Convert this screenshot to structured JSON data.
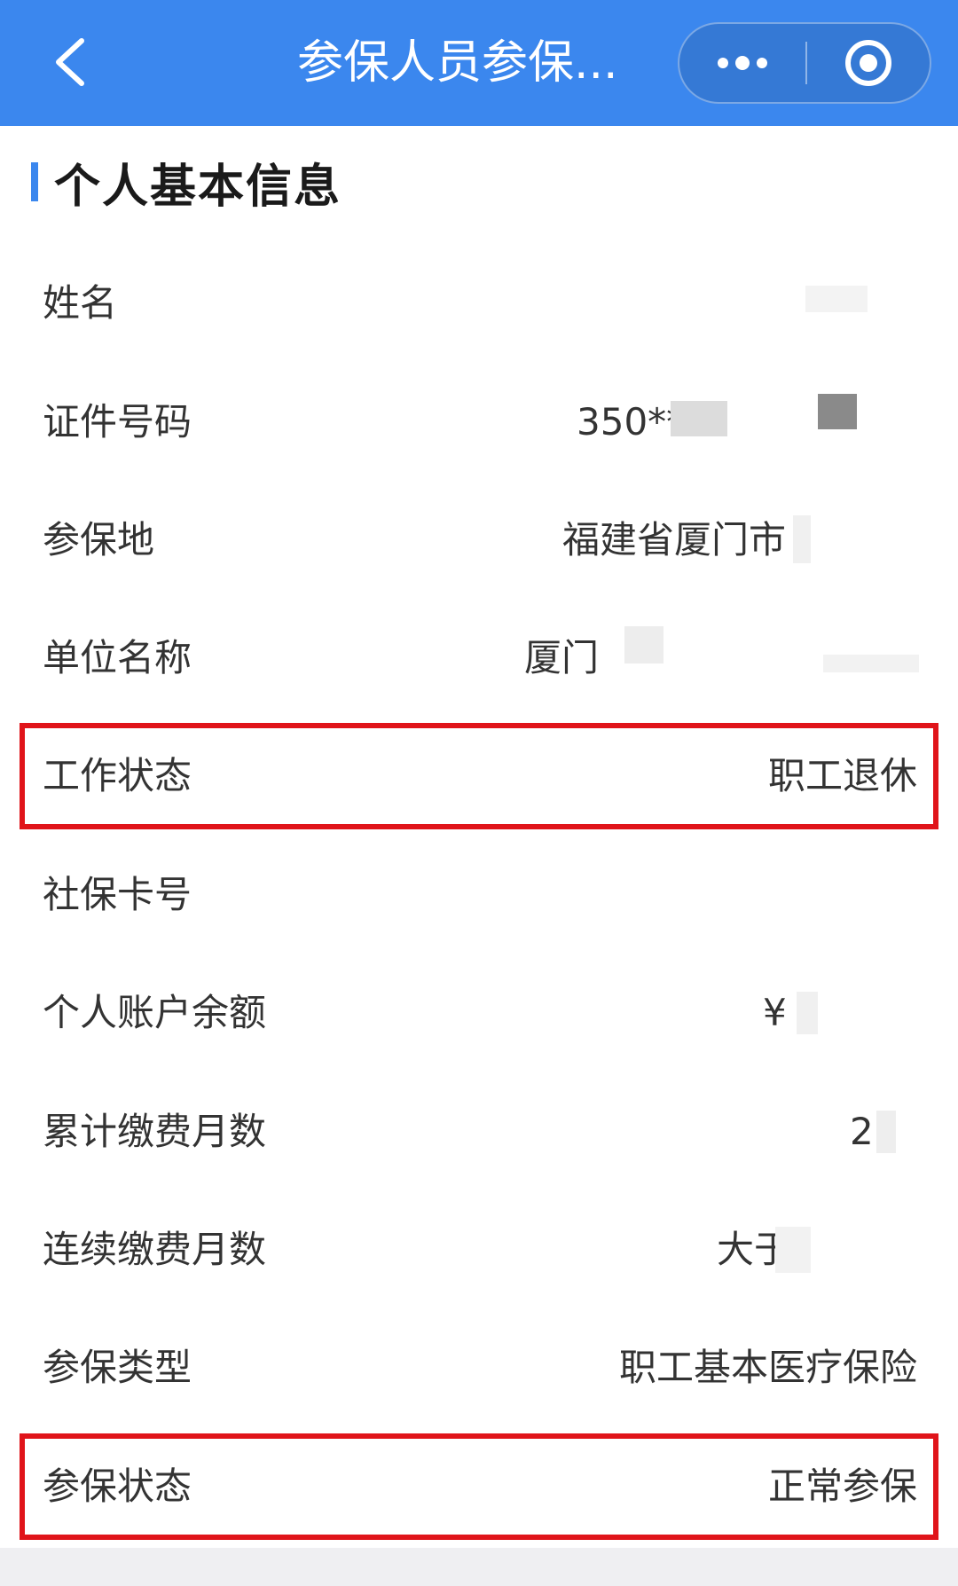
{
  "header": {
    "title": "参保人员参保...",
    "back_icon": "chevron-left-icon",
    "more_icon": "more-dots-icon",
    "close_icon": "target-circle-icon",
    "bg_color": "#3b87ee"
  },
  "section": {
    "title": "个人基本信息",
    "accent_color": "#3b87ee"
  },
  "rows": [
    {
      "label": "姓名",
      "value": ""
    },
    {
      "label": "证件号码",
      "value": "350**"
    },
    {
      "label": "参保地",
      "value": "福建省厦门市"
    },
    {
      "label": "单位名称",
      "value": "厦门"
    },
    {
      "label": "工作状态",
      "value": "职工退休",
      "highlighted": true
    },
    {
      "label": "社保卡号",
      "value": ""
    },
    {
      "label": "个人账户余额",
      "value": "¥"
    },
    {
      "label": "累计缴费月数",
      "value": "2"
    },
    {
      "label": "连续缴费月数",
      "value": "大于"
    },
    {
      "label": "参保类型",
      "value": "职工基本医疗保险"
    },
    {
      "label": "参保状态",
      "value": "正常参保",
      "highlighted": true
    }
  ],
  "highlight_color": "#e0141a"
}
